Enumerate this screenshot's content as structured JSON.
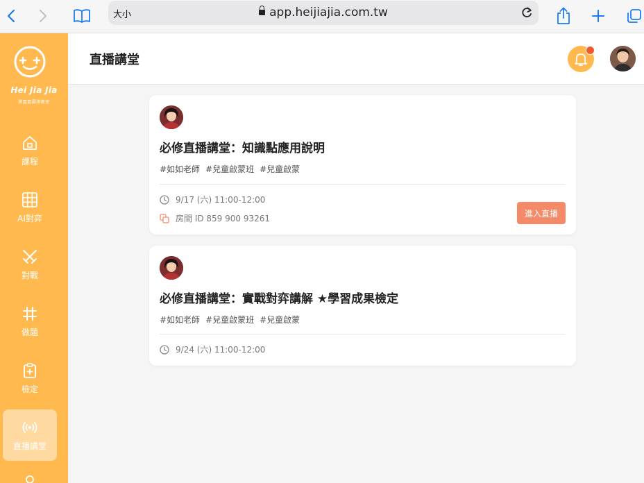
{
  "browser": {
    "text_size_label": "大小",
    "url": "app.heijiajia.com.tw"
  },
  "brand": {
    "name": "Hei Jia Jia",
    "tagline": "黑嘉嘉圍棋教室"
  },
  "sidebar": {
    "items": [
      {
        "label": "課程",
        "icon": "home-icon"
      },
      {
        "label": "AI對弈",
        "icon": "grid-icon"
      },
      {
        "label": "對戰",
        "icon": "crossed-swords-icon"
      },
      {
        "label": "做題",
        "icon": "hash-icon"
      },
      {
        "label": "檢定",
        "icon": "clipboard-icon"
      },
      {
        "label": "直播講堂",
        "icon": "broadcast-icon",
        "active": true
      }
    ]
  },
  "header": {
    "title": "直播講堂"
  },
  "lessons": [
    {
      "title": "必修直播講堂：知識點應用說明",
      "tags": [
        "#如如老師",
        "#兒童啟蒙班",
        "#兒童啟蒙"
      ],
      "time": "9/17 (六) 11:00-12:00",
      "room": "房間 ID 859 900 93261",
      "button": "進入直播"
    },
    {
      "title": "必修直播講堂：實戰對弈講解 ★學習成果檢定",
      "tags": [
        "#如如老師",
        "#兒童啟蒙班",
        "#兒童啟蒙"
      ],
      "time": "9/24 (六) 11:00-12:00"
    }
  ],
  "colors": {
    "brand_orange": "#ffb94e",
    "button_coral": "#f58a68",
    "notification_dot": "#f25a2a"
  }
}
